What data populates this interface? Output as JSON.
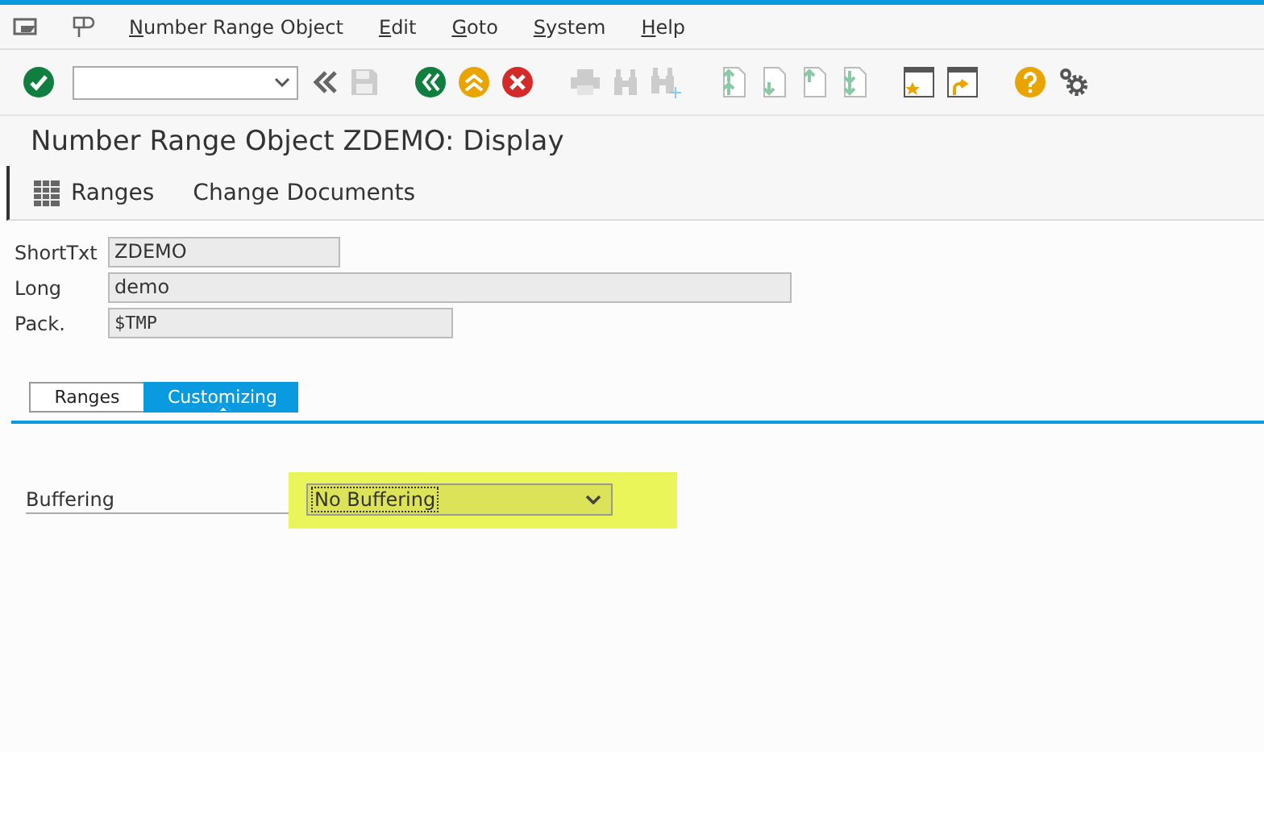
{
  "menu": [
    "Number Range Object",
    "Edit",
    "Goto",
    "System",
    "Help"
  ],
  "title": "Number Range Object ZDEMO: Display",
  "app_toolbar": [
    {
      "label": "Ranges",
      "kind": "icon"
    },
    {
      "label": "Change Documents",
      "kind": "plain"
    }
  ],
  "fields": [
    {
      "label": "ShortTxt",
      "value": "ZDEMO",
      "kind": "short"
    },
    {
      "label": "Long",
      "value": "demo",
      "kind": "long"
    },
    {
      "label": "Pack.",
      "value": "$TMP",
      "kind": "mono"
    }
  ],
  "tabs": [
    {
      "label": "Ranges",
      "selected": false
    },
    {
      "label": "Customizing",
      "selected": true
    }
  ],
  "buffering": {
    "label": "Buffering",
    "value": "No Buffering",
    "highlighted": true
  }
}
